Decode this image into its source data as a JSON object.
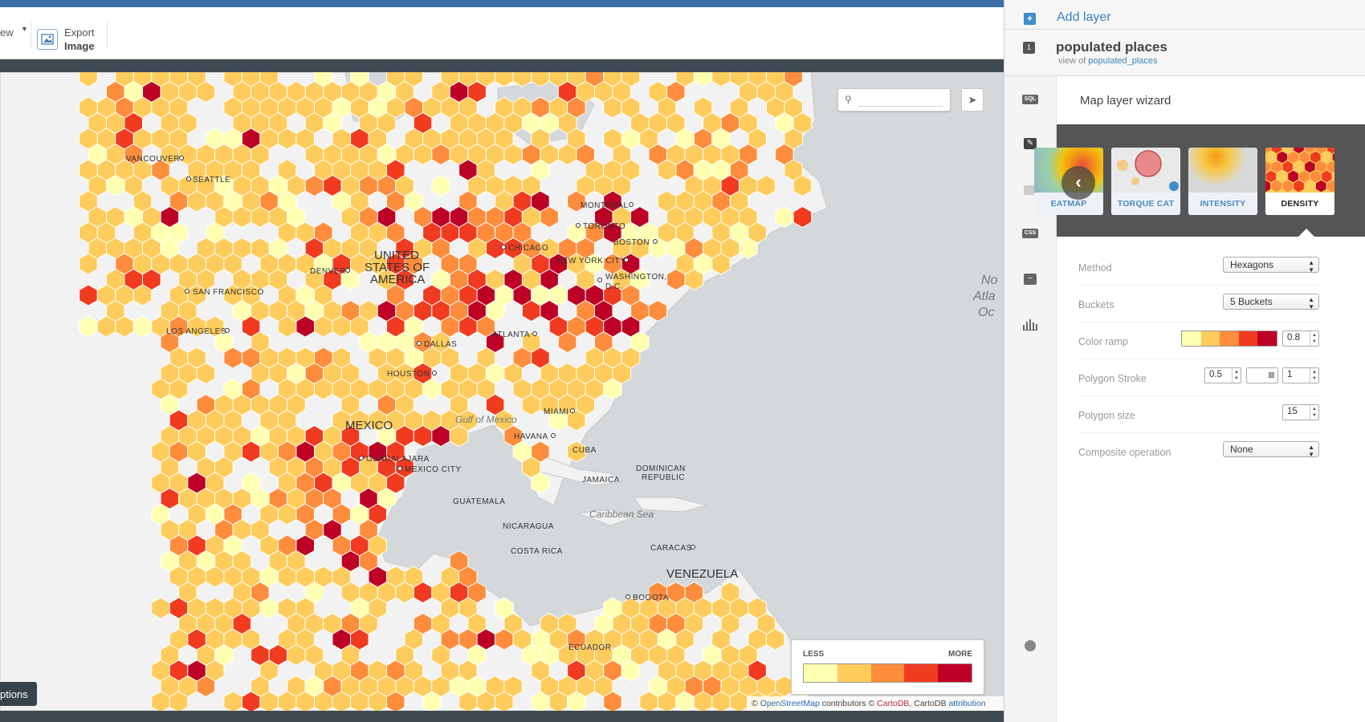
{
  "toolbar": {
    "view_label": "ew",
    "export_label_1": "Export",
    "export_label_2": "Image"
  },
  "map": {
    "search_placeholder": "",
    "legend": {
      "less": "LESS",
      "more": "MORE",
      "colors": [
        "#ffffb2",
        "#fecc5c",
        "#fd8d3c",
        "#f03b20",
        "#bd0026"
      ]
    },
    "options_label": "ptions",
    "attribution": {
      "prefix": "© ",
      "osm": "OpenStreetMap",
      "contributors": " contributors © ",
      "cartodb": "CartoDB",
      "middle": ", CartoDB ",
      "attr": "attribution"
    },
    "cities": [
      {
        "name": "VANCOUVER"
      },
      {
        "name": "SEATTLE"
      },
      {
        "name": "SAN FRANCISCO"
      },
      {
        "name": "LOS ANGELES"
      },
      {
        "name": "DENVER"
      },
      {
        "name": "DALLAS"
      },
      {
        "name": "HOUSTON"
      },
      {
        "name": "CHICAGO"
      },
      {
        "name": "TORONTO"
      },
      {
        "name": "MONTRÉAL"
      },
      {
        "name": "BOSTON"
      },
      {
        "name": "NEW YORK CITY"
      },
      {
        "name": "WASHINGTON,"
      },
      {
        "name": "D.C."
      },
      {
        "name": "ATLANTA"
      },
      {
        "name": "MIAMI"
      },
      {
        "name": "HAVANA"
      },
      {
        "name": "GUADALAJARA"
      },
      {
        "name": "MEXICO CITY"
      },
      {
        "name": "GUATEMALA"
      },
      {
        "name": "NICARAGUA"
      },
      {
        "name": "COSTA RICA"
      },
      {
        "name": "CARACAS"
      },
      {
        "name": "BOGOTA"
      },
      {
        "name": "CUBA"
      },
      {
        "name": "JAMAICA"
      },
      {
        "name": "DOMINICAN"
      },
      {
        "name": "REPUBLIC"
      },
      {
        "name": "ECUADOR"
      }
    ],
    "countries": [
      {
        "name": "UNITED"
      },
      {
        "name": "STATES OF"
      },
      {
        "name": "AMERICA"
      },
      {
        "name": "MEXICO"
      },
      {
        "name": "VENEZUELA"
      }
    ],
    "seas": [
      {
        "name": "Gulf of Mexico"
      },
      {
        "name": "Caribbean Sea"
      },
      {
        "name": "No"
      },
      {
        "name": "Atla"
      },
      {
        "name": "Oc"
      }
    ]
  },
  "panel": {
    "add_layer": "Add layer",
    "layer_number": "1",
    "layer_name": "populated places",
    "view_of": "view of ",
    "table_name": "populated_places",
    "wizard_title": "Map layer wizard",
    "thumbs": [
      {
        "label": "EATMAP"
      },
      {
        "label": "TORQUE CAT"
      },
      {
        "label": "INTENSITY"
      },
      {
        "label": "DENSITY"
      }
    ],
    "sidebar_icons": {
      "sql": "SQL",
      "css": "CSS"
    },
    "fields": {
      "method": {
        "label": "Method",
        "value": "Hexagons"
      },
      "buckets": {
        "label": "Buckets",
        "value": "5 Buckets"
      },
      "color_ramp": {
        "label": "Color ramp",
        "opacity": "0.8",
        "colors": [
          "#ffffb2",
          "#fecc5c",
          "#fd8d3c",
          "#f03b20",
          "#bd0026"
        ]
      },
      "polygon_stroke": {
        "label": "Polygon Stroke",
        "width": "0.5",
        "opacity": "1"
      },
      "polygon_size": {
        "label": "Polygon size",
        "value": "15"
      },
      "composite": {
        "label": "Composite operation",
        "value": "None"
      }
    }
  }
}
